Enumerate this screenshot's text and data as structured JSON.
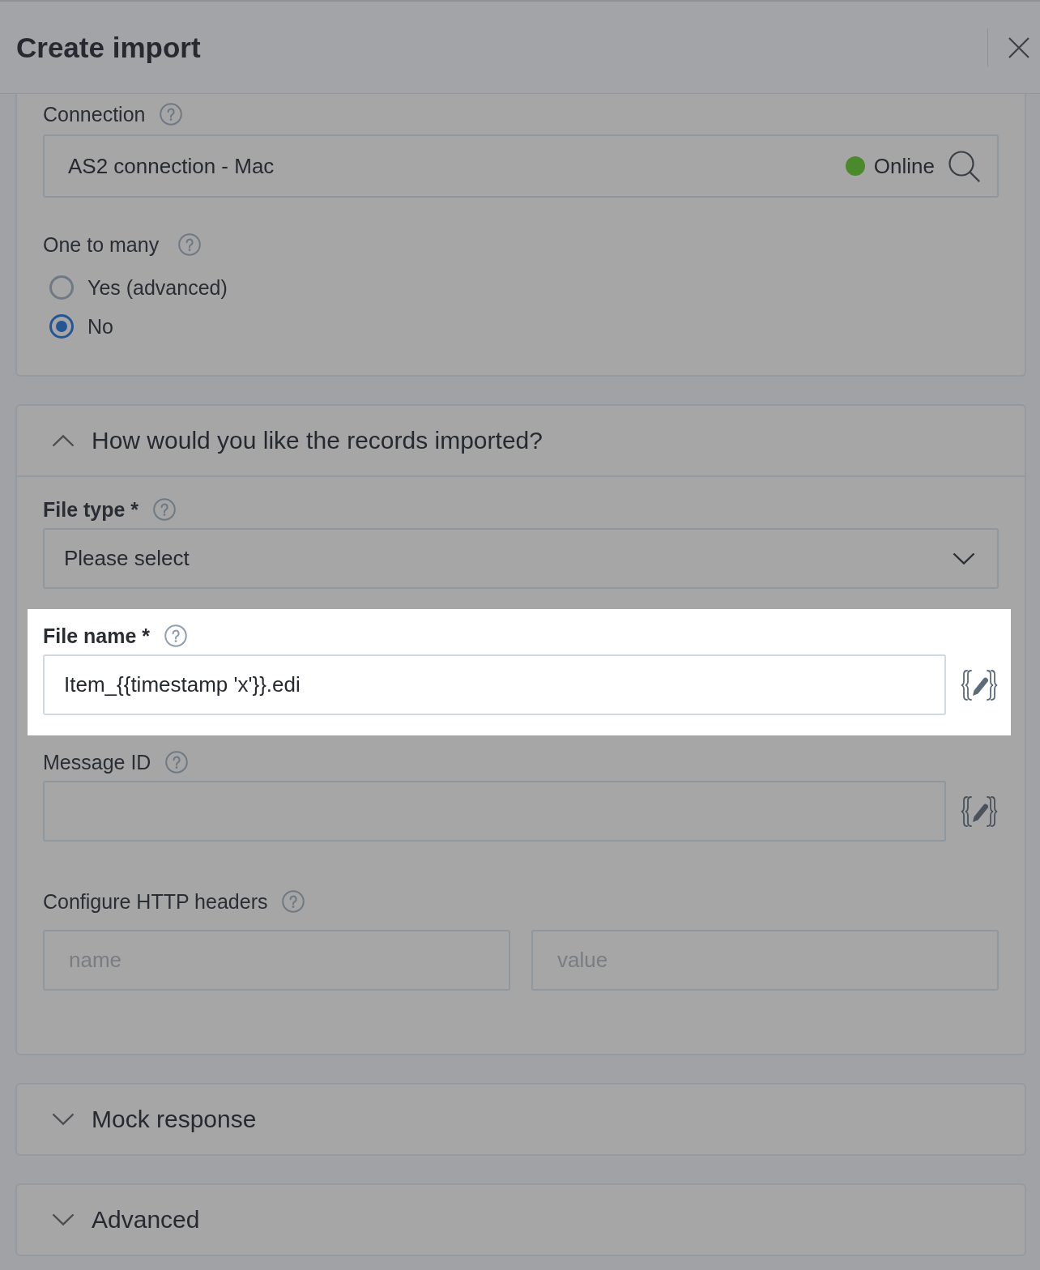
{
  "dialog": {
    "title": "Create import"
  },
  "sections": [
    {
      "fields": [
        {
          "kind": "lookup",
          "label": "Connection",
          "required": false,
          "highlighted": false,
          "value": "AS2 connection - Mac",
          "status": "Online",
          "online": true
        },
        {
          "kind": "radio",
          "label": "One to many",
          "required": false,
          "highlighted": false,
          "options": [
            {
              "label": "Yes (advanced)",
              "selected": false
            },
            {
              "label": "No",
              "selected": true
            }
          ]
        }
      ]
    },
    {
      "title": "How would you like the records imported?",
      "expanded": true,
      "fields": [
        {
          "kind": "select",
          "label": "File type *",
          "required": true,
          "highlighted": false,
          "placeholder": "Please select"
        },
        {
          "kind": "text",
          "label": "File name *",
          "required": true,
          "highlighted": true,
          "value": "Item_{{timestamp 'x'}}.edi"
        },
        {
          "kind": "text",
          "label": "Message ID",
          "required": false,
          "highlighted": false
        },
        {
          "kind": "pairs",
          "label": "Configure HTTP headers",
          "required": false,
          "highlighted": false,
          "inputs": [
            {
              "placeholder": "name"
            },
            {
              "placeholder": "value"
            }
          ]
        }
      ]
    },
    {
      "title": "Mock response",
      "expanded": false
    },
    {
      "title": "Advanced",
      "expanded": false
    }
  ]
}
